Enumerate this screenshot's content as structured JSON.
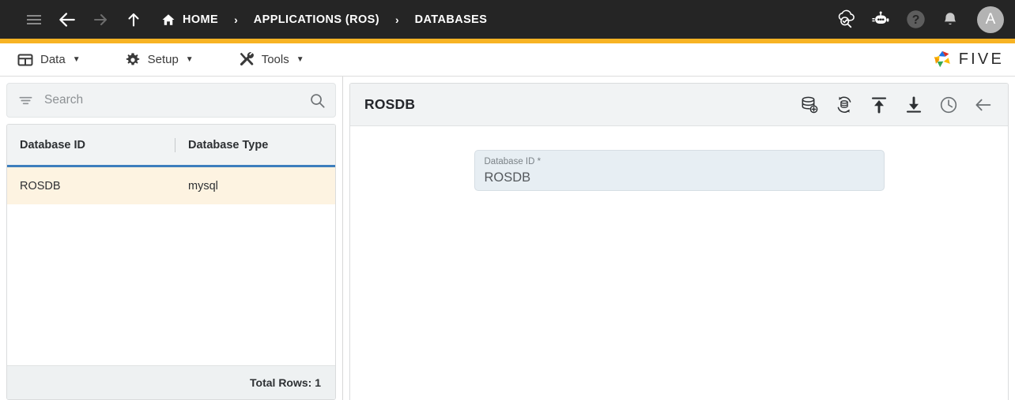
{
  "header": {
    "nav": [
      {
        "name": "menu-icon",
        "label": "Menu"
      },
      {
        "name": "back-arrow-icon",
        "label": "Back"
      },
      {
        "name": "forward-arrow-icon",
        "label": "Forward"
      },
      {
        "name": "up-arrow-icon",
        "label": "Up"
      }
    ],
    "breadcrumbs": [
      {
        "label": "HOME",
        "icon": "home-icon"
      },
      {
        "label": "APPLICATIONS (ROS)",
        "icon": ""
      },
      {
        "label": "DATABASES",
        "icon": ""
      }
    ],
    "separator": "›",
    "actions": [
      {
        "name": "cloud-check-icon",
        "label": "Deploy"
      },
      {
        "name": "chat-bot-icon",
        "label": "Assistant"
      },
      {
        "name": "help-icon",
        "label": "Help"
      },
      {
        "name": "bell-icon",
        "label": "Notifications"
      }
    ],
    "avatar_initial": "A",
    "accent_color": "#f7b324",
    "background_color": "#252525"
  },
  "menubar": {
    "items": [
      {
        "label": "Data",
        "icon": "table-icon",
        "caret": "▼"
      },
      {
        "label": "Setup",
        "icon": "gear-icon",
        "caret": "▼"
      },
      {
        "label": "Tools",
        "icon": "tools-icon",
        "caret": "▼"
      }
    ],
    "logo_text": "FIVE"
  },
  "sidebar": {
    "search": {
      "placeholder": "Search",
      "value": "",
      "filter_icon": "filter-icon",
      "search_icon": "search-icon"
    },
    "table": {
      "columns": [
        "Database ID",
        "Database Type"
      ],
      "rows": [
        {
          "database_id": "ROSDB",
          "database_type": "mysql",
          "selected": true
        }
      ],
      "footer_label": "Total Rows: 1",
      "selected_row_color": "#fdf3e1",
      "header_underline_color": "#3d7ebd"
    }
  },
  "detail": {
    "title": "ROSDB",
    "toolbar": [
      {
        "name": "database-add-icon",
        "label": "New Database"
      },
      {
        "name": "database-sync-icon",
        "label": "Sync Database"
      },
      {
        "name": "upload-icon",
        "label": "Upload"
      },
      {
        "name": "download-icon",
        "label": "Download"
      },
      {
        "name": "history-clock-icon",
        "label": "History"
      },
      {
        "name": "back-icon",
        "label": "Back"
      }
    ],
    "fields": [
      {
        "label": "Database ID *",
        "value": "ROSDB",
        "name": "database-id-field"
      }
    ]
  }
}
